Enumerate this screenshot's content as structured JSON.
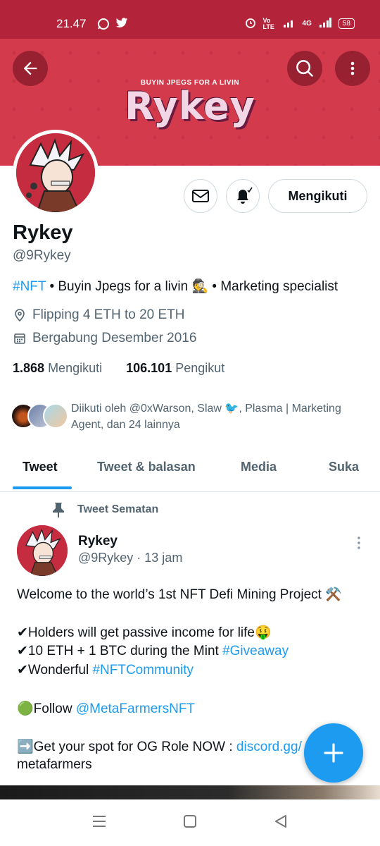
{
  "status": {
    "time": "21.47",
    "network": "4G",
    "carrier": "Vo LTE",
    "battery": "58"
  },
  "banner": {
    "subtitle": "BUYIN JPEGS FOR A LIVIN",
    "title": "Rykey"
  },
  "profile": {
    "name": "Rykey",
    "handle": "@9Rykey",
    "bio_hashtag": "#NFT",
    "bio_text": " • Buyin Jpegs for a livin 🕵 • Marketing specialist",
    "location": "Flipping 4 ETH to 20 ETH",
    "joined": "Bergabung Desember 2016",
    "following_count": "1.868",
    "following_label": "Mengikuti",
    "followers_count": "106.101",
    "followers_label": "Pengikut",
    "followed_by": "Diikuti oleh @0xWarson, Slaw 🐦, Plasma | Marketing Agent, dan 24 lainnya",
    "follow_button": "Mengikuti"
  },
  "tabs": [
    "Tweet",
    "Tweet & balasan",
    "Media",
    "Suka"
  ],
  "tweet": {
    "pinned_label": "Tweet Sematan",
    "name": "Rykey",
    "handle_time": "@9Rykey · 13 jam",
    "line1": "Welcome to the world’s 1st NFT Defi Mining Project ⚒️",
    "line2": "✔Holders will get passive income for life🤑",
    "line3a": "✔10 ETH + 1 BTC during the Mint ",
    "line3b": "#Giveaway",
    "line4a": "✔Wonderful ",
    "line4b": "#NFTCommunity",
    "line5a": "🟢Follow ",
    "line5b": "@MetaFarmersNFT",
    "line6a": "➡️Get your spot for OG Role NOW : ",
    "line6b": "discord.gg/",
    "line7": "metafarmers"
  },
  "colors": {
    "banner": "#d33a4c",
    "accent": "#1d9bf0",
    "statusbar": "#b3243b"
  },
  "icons": [
    "back-arrow-icon",
    "search-icon",
    "more-vertical-icon",
    "mail-icon",
    "bell-icon",
    "location-icon",
    "calendar-icon",
    "pin-icon",
    "compose-icon"
  ]
}
